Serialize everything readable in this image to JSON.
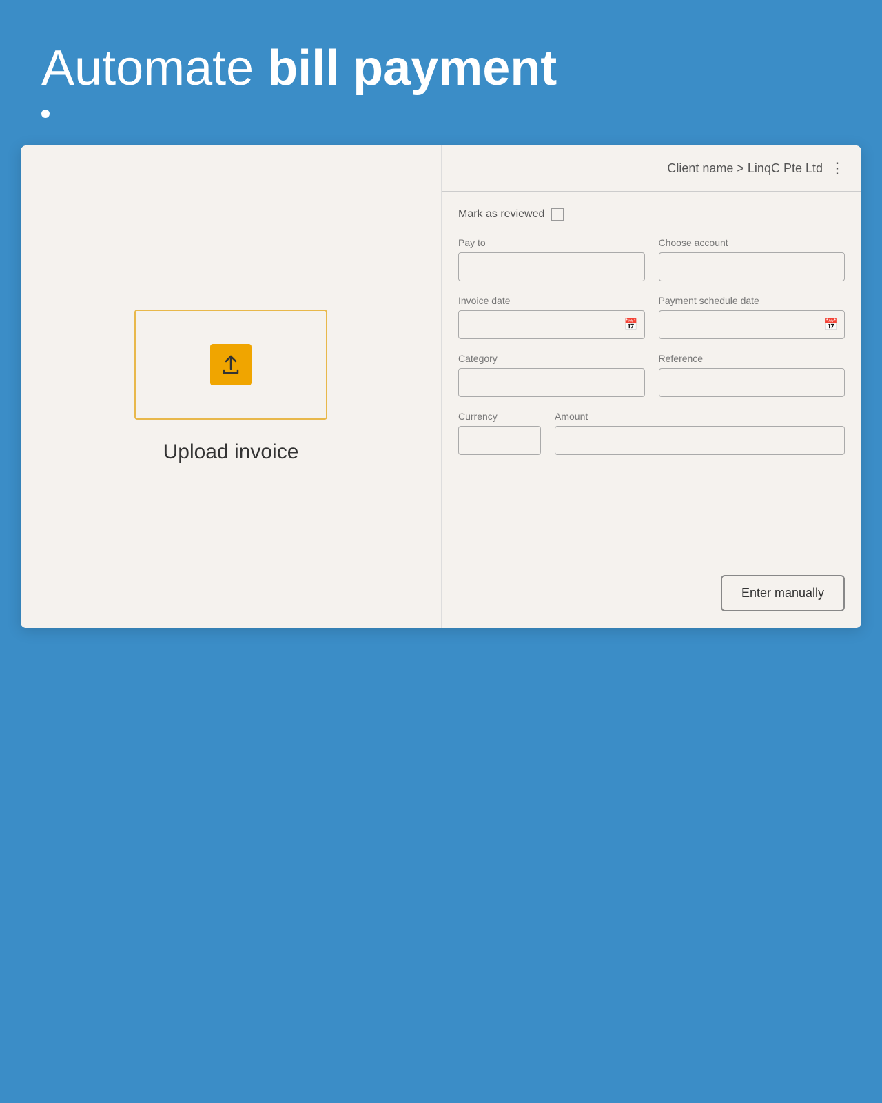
{
  "header": {
    "title_plain": "Automate ",
    "title_bold": "bill payment"
  },
  "breadcrumb": {
    "text": "Client name > LinqC Pte Ltd"
  },
  "form": {
    "mark_reviewed_label": "Mark as reviewed",
    "pay_to_label": "Pay to",
    "choose_account_label": "Choose account",
    "invoice_date_label": "Invoice date",
    "payment_schedule_label": "Payment schedule date",
    "category_label": "Category",
    "reference_label": "Reference",
    "currency_label": "Currency",
    "amount_label": "Amount"
  },
  "upload": {
    "label": "Upload invoice"
  },
  "actions": {
    "enter_manually": "Enter manually"
  }
}
